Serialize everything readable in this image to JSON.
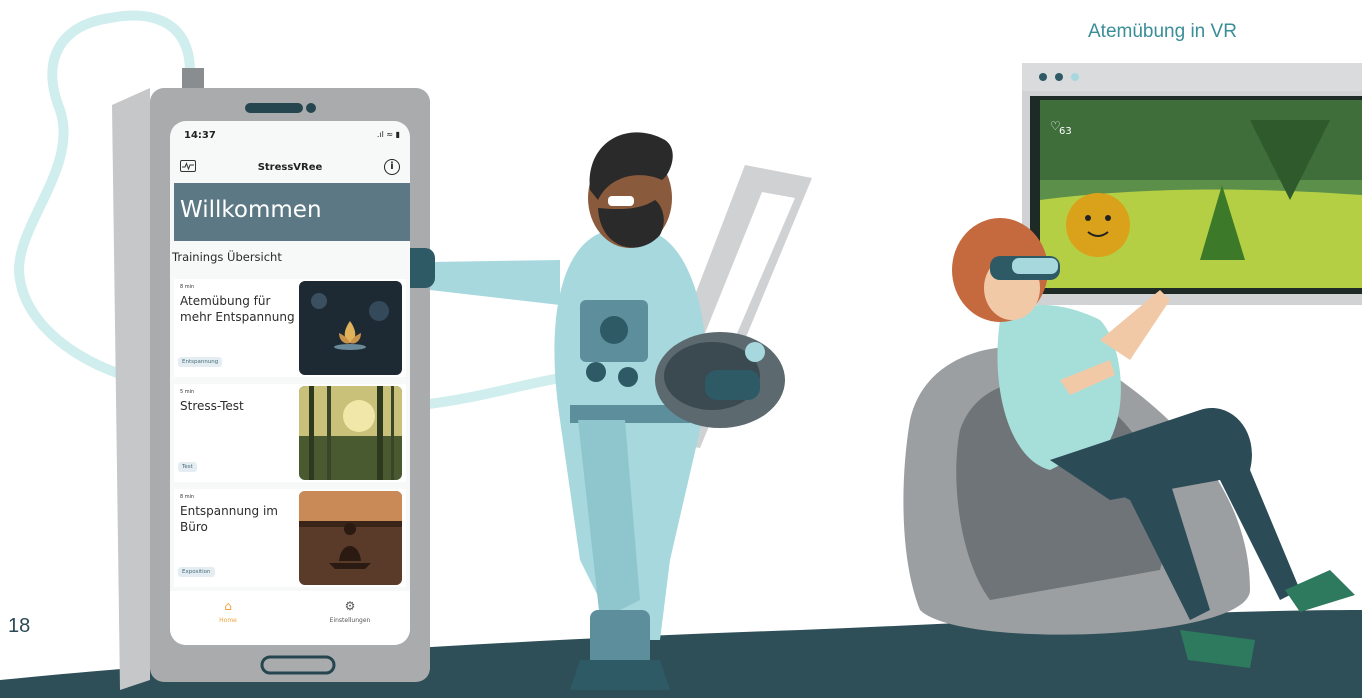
{
  "phone": {
    "status_time": "14:37",
    "status_icons": ".ıl ≈ ▮",
    "app_title": "StressVRee",
    "info_glyph": "i",
    "welcome_banner": "Willkommen",
    "section_title": "Trainings Übersicht",
    "trainings": [
      {
        "duration": "8 min",
        "title": "Atemübung für mehr Entspannung",
        "tag": "Entspannung"
      },
      {
        "duration": "5 min",
        "title": "Stress-Test",
        "tag": "Test"
      },
      {
        "duration": "8 min",
        "title": "Entspannung im Büro",
        "tag": "Exposition"
      }
    ],
    "tabs": [
      {
        "label": "Home",
        "icon": "home-icon"
      },
      {
        "label": "Einstellungen",
        "icon": "gear-icon"
      }
    ]
  },
  "vr": {
    "heading": "Atemübung in VR",
    "heart_rate": "63"
  },
  "page_number": "18",
  "colors": {
    "teal_dark": "#2e5a66",
    "teal_light": "#a6d8de",
    "welcome_banner": "#5c7884",
    "accent_text": "#3a8e98",
    "home_tab": "#f0a23c",
    "floor": "#2f4f58"
  }
}
